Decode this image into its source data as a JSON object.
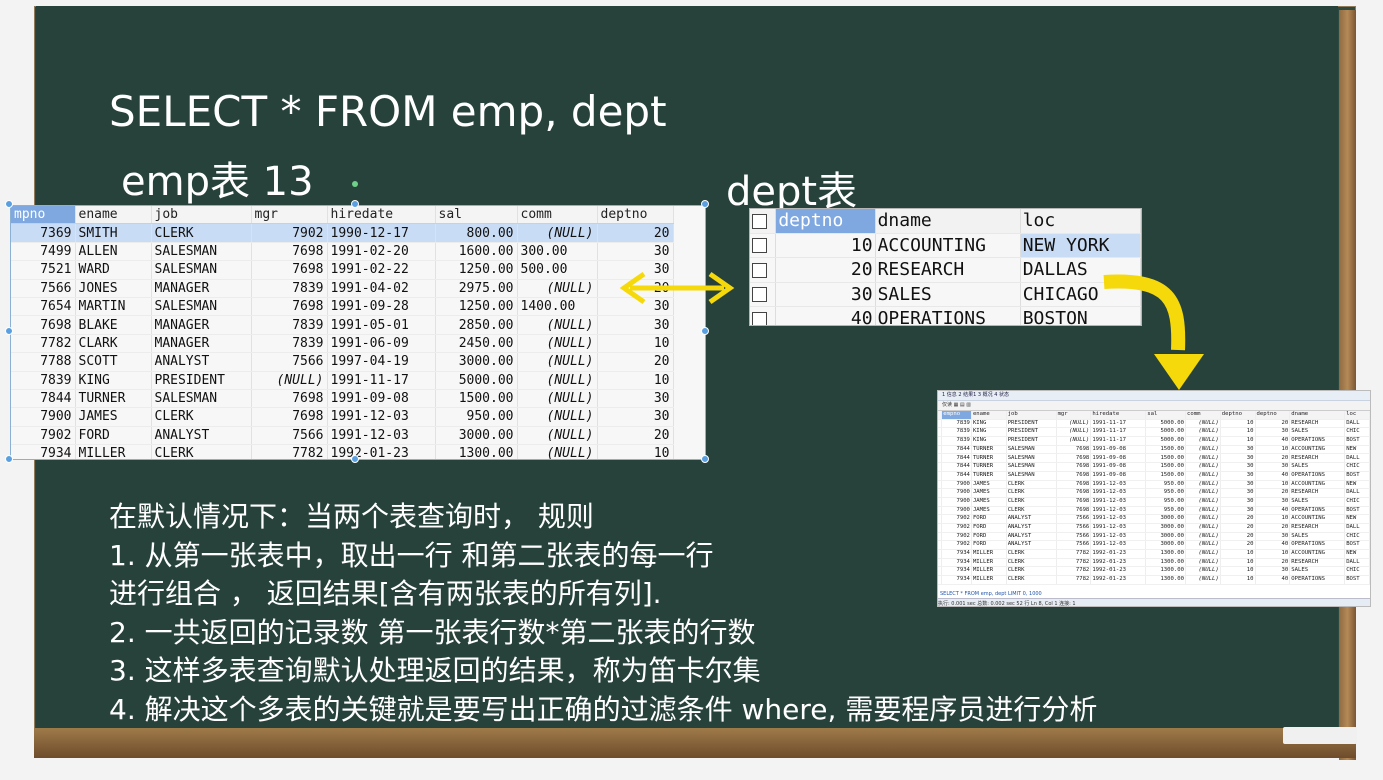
{
  "slide": {
    "title": "SELECT * FROM emp, dept",
    "emp_label": "emp表 13",
    "dept_label": "dept表",
    "rules": [
      "在默认情况下：当两个表查询时， 规则",
      "1. 从第一张表中，取出一行 和第二张表的每一行",
      "进行组合 ， 返回结果[含有两张表的所有列].",
      "2. 一共返回的记录数 第一张表行数*第二张表的行数",
      "3. 这样多表查询默认处理返回的结果，称为笛卡尔集",
      "4. 解决这个多表的关键就是要写出正确的过滤条件 where, 需要程序员进行分析"
    ]
  },
  "emp_table": {
    "columns": [
      "mpno",
      "ename",
      "job",
      "mgr",
      "hiredate",
      "sal",
      "comm",
      "deptno"
    ],
    "rows": [
      [
        "7369",
        "SMITH",
        "CLERK",
        "7902",
        "1990-12-17",
        "800.00",
        "(NULL)",
        "20"
      ],
      [
        "7499",
        "ALLEN",
        "SALESMAN",
        "7698",
        "1991-02-20",
        "1600.00",
        "300.00",
        "30"
      ],
      [
        "7521",
        "WARD",
        "SALESMAN",
        "7698",
        "1991-02-22",
        "1250.00",
        "500.00",
        "30"
      ],
      [
        "7566",
        "JONES",
        "MANAGER",
        "7839",
        "1991-04-02",
        "2975.00",
        "(NULL)",
        "20"
      ],
      [
        "7654",
        "MARTIN",
        "SALESMAN",
        "7698",
        "1991-09-28",
        "1250.00",
        "1400.00",
        "30"
      ],
      [
        "7698",
        "BLAKE",
        "MANAGER",
        "7839",
        "1991-05-01",
        "2850.00",
        "(NULL)",
        "30"
      ],
      [
        "7782",
        "CLARK",
        "MANAGER",
        "7839",
        "1991-06-09",
        "2450.00",
        "(NULL)",
        "10"
      ],
      [
        "7788",
        "SCOTT",
        "ANALYST",
        "7566",
        "1997-04-19",
        "3000.00",
        "(NULL)",
        "20"
      ],
      [
        "7839",
        "KING",
        "PRESIDENT",
        "(NULL)",
        "1991-11-17",
        "5000.00",
        "(NULL)",
        "10"
      ],
      [
        "7844",
        "TURNER",
        "SALESMAN",
        "7698",
        "1991-09-08",
        "1500.00",
        "(NULL)",
        "30"
      ],
      [
        "7900",
        "JAMES",
        "CLERK",
        "7698",
        "1991-12-03",
        "950.00",
        "(NULL)",
        "30"
      ],
      [
        "7902",
        "FORD",
        "ANALYST",
        "7566",
        "1991-12-03",
        "3000.00",
        "(NULL)",
        "20"
      ],
      [
        "7934",
        "MILLER",
        "CLERK",
        "7782",
        "1992-01-23",
        "1300.00",
        "(NULL)",
        "10"
      ]
    ]
  },
  "dept_table": {
    "columns": [
      "deptno",
      "dname",
      "loc"
    ],
    "rows": [
      [
        "10",
        "ACCOUNTING",
        "NEW YORK"
      ],
      [
        "20",
        "RESEARCH",
        "DALLAS"
      ],
      [
        "30",
        "SALES",
        "CHICAGO"
      ],
      [
        "40",
        "OPERATIONS",
        "BOSTON"
      ]
    ]
  },
  "result_table": {
    "toolbar": "1 信息   2 结果1   3 概况   4 状态",
    "toolbar2": "仅读   ▦ ▤ ▥",
    "columns": [
      "empno",
      "ename",
      "job",
      "mgr",
      "hiredate",
      "sal",
      "comm",
      "deptno",
      "deptno",
      "dname",
      "loc"
    ],
    "rows": [
      [
        "7839",
        "KING",
        "PRESIDENT",
        "(NULL)",
        "1991-11-17",
        "5000.00",
        "(NULL)",
        "10",
        "20",
        "RESEARCH",
        "DALL"
      ],
      [
        "7839",
        "KING",
        "PRESIDENT",
        "(NULL)",
        "1991-11-17",
        "5000.00",
        "(NULL)",
        "10",
        "30",
        "SALES",
        "CHIC"
      ],
      [
        "7839",
        "KING",
        "PRESIDENT",
        "(NULL)",
        "1991-11-17",
        "5000.00",
        "(NULL)",
        "10",
        "40",
        "OPERATIONS",
        "BOST"
      ],
      [
        "7844",
        "TURNER",
        "SALESMAN",
        "7698",
        "1991-09-08",
        "1500.00",
        "(NULL)",
        "30",
        "10",
        "ACCOUNTING",
        "NEW"
      ],
      [
        "7844",
        "TURNER",
        "SALESMAN",
        "7698",
        "1991-09-08",
        "1500.00",
        "(NULL)",
        "30",
        "20",
        "RESEARCH",
        "DALL"
      ],
      [
        "7844",
        "TURNER",
        "SALESMAN",
        "7698",
        "1991-09-08",
        "1500.00",
        "(NULL)",
        "30",
        "30",
        "SALES",
        "CHIC"
      ],
      [
        "7844",
        "TURNER",
        "SALESMAN",
        "7698",
        "1991-09-08",
        "1500.00",
        "(NULL)",
        "30",
        "40",
        "OPERATIONS",
        "BOST"
      ],
      [
        "7900",
        "JAMES",
        "CLERK",
        "7698",
        "1991-12-03",
        "950.00",
        "(NULL)",
        "30",
        "10",
        "ACCOUNTING",
        "NEW"
      ],
      [
        "7900",
        "JAMES",
        "CLERK",
        "7698",
        "1991-12-03",
        "950.00",
        "(NULL)",
        "30",
        "20",
        "RESEARCH",
        "DALL"
      ],
      [
        "7900",
        "JAMES",
        "CLERK",
        "7698",
        "1991-12-03",
        "950.00",
        "(NULL)",
        "30",
        "30",
        "SALES",
        "CHIC"
      ],
      [
        "7900",
        "JAMES",
        "CLERK",
        "7698",
        "1991-12-03",
        "950.00",
        "(NULL)",
        "30",
        "40",
        "OPERATIONS",
        "BOST"
      ],
      [
        "7902",
        "FORD",
        "ANALYST",
        "7566",
        "1991-12-03",
        "3000.00",
        "(NULL)",
        "20",
        "10",
        "ACCOUNTING",
        "NEW"
      ],
      [
        "7902",
        "FORD",
        "ANALYST",
        "7566",
        "1991-12-03",
        "3000.00",
        "(NULL)",
        "20",
        "20",
        "RESEARCH",
        "DALL"
      ],
      [
        "7902",
        "FORD",
        "ANALYST",
        "7566",
        "1991-12-03",
        "3000.00",
        "(NULL)",
        "20",
        "30",
        "SALES",
        "CHIC"
      ],
      [
        "7902",
        "FORD",
        "ANALYST",
        "7566",
        "1991-12-03",
        "3000.00",
        "(NULL)",
        "20",
        "40",
        "OPERATIONS",
        "BOST"
      ],
      [
        "7934",
        "MILLER",
        "CLERK",
        "7782",
        "1992-01-23",
        "1300.00",
        "(NULL)",
        "10",
        "10",
        "ACCOUNTING",
        "NEW"
      ],
      [
        "7934",
        "MILLER",
        "CLERK",
        "7782",
        "1992-01-23",
        "1300.00",
        "(NULL)",
        "10",
        "20",
        "RESEARCH",
        "DALL"
      ],
      [
        "7934",
        "MILLER",
        "CLERK",
        "7782",
        "1992-01-23",
        "1300.00",
        "(NULL)",
        "10",
        "30",
        "SALES",
        "CHIC"
      ],
      [
        "7934",
        "MILLER",
        "CLERK",
        "7782",
        "1992-01-23",
        "1300.00",
        "(NULL)",
        "10",
        "40",
        "OPERATIONS",
        "BOST"
      ]
    ],
    "sql_line": "SELECT * FROM emp, dept LIMIT 0, 1000",
    "status": "执行: 0.001 sec    总数: 0.002 sec    52 行    Ln 8, Col 1    连接: 1"
  },
  "colors": {
    "board": "#27423b",
    "arrow": "#f5d90a",
    "header_highlight": "#7fa8e0",
    "selected_row": "#c9dcf5"
  }
}
